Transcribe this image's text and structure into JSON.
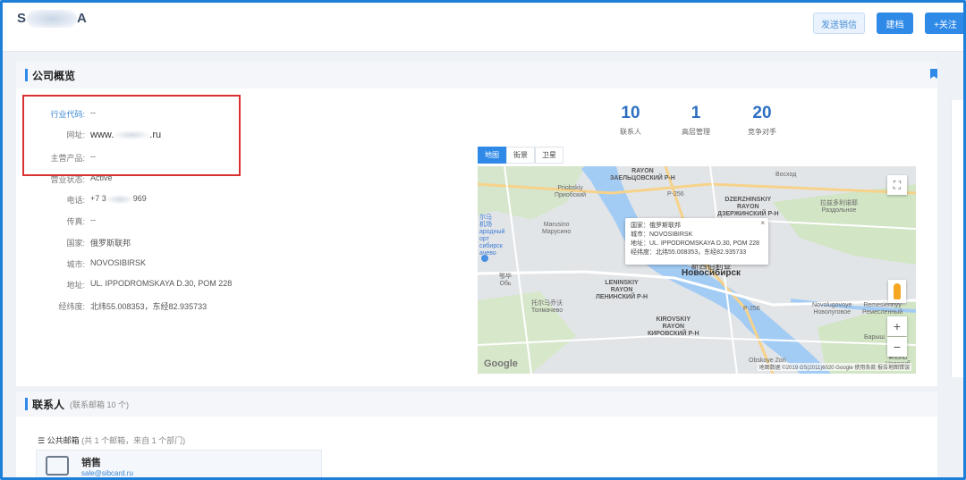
{
  "header": {
    "logo_left": "S",
    "logo_right": "A",
    "btn_send_message": "发送销信",
    "btn_archive": "建档",
    "btn_follow": "+关注"
  },
  "overview": {
    "title": "公司概览",
    "fields": [
      {
        "label": "行业代码:",
        "value": "--"
      },
      {
        "label": "网址:",
        "value_prefix": "www.",
        "value_suffix": ".ru"
      },
      {
        "label": "主营产品:",
        "value": "--"
      },
      {
        "label": "营业状态:",
        "value": "Active"
      },
      {
        "label": "电话:",
        "value_prefix": "+7 3",
        "value_suffix": "969"
      },
      {
        "label": "传真:",
        "value": "--"
      },
      {
        "label": "国家:",
        "value": "俄罗斯联邦"
      },
      {
        "label": "城市:",
        "value": "NOVOSIBIRSK"
      },
      {
        "label": "地址:",
        "value": "UL. IPPODROMSKAYA D.30, POM 228"
      },
      {
        "label": "经纬度:",
        "value": "北纬55.008353，东经82.935733"
      }
    ],
    "stats": [
      {
        "number": "10",
        "label": "联系人"
      },
      {
        "number": "1",
        "label": "高层管理"
      },
      {
        "number": "20",
        "label": "竞争对手"
      }
    ]
  },
  "map": {
    "tabs": [
      "地图",
      "街景",
      "卫星"
    ],
    "active_tab": "地图",
    "labels": {
      "zaeltsovsky": "RAYON\nЗАЕЛЬЦОВСКИЙ Р-Н",
      "dzerzhinsky": "DZERZHINSKIY\nRAYON\nДЗЕРЖИНСКИЙ Р-Н",
      "leninsky": "LENINSKIY\nRAYON\nЛЕНИНСКИЙ Р-Н",
      "kirovsky": "KIROVSKIY\nRAYON\nКИРОВСКИЙ Р-Н",
      "city_cn": "新西伯利亚",
      "city_ru": "Новосибирск",
      "voskhod": "Восход",
      "priobsky": "Priobskiy\nПриобский",
      "marusino": "Marusino\nМарусино",
      "razdolnoye": "拉兹多利诺耶\nРаздольное",
      "tolmachevo": "托尔马乔沃\nТолмачево",
      "ob": "鄂毕\nОбь",
      "novolugovoye": "Novolugovoye\nНоволуговое",
      "remeslenny": "Remesiennyy\nРемесленный",
      "barysh": "Барыш",
      "obskoye": "Obskoye Zori",
      "newnovo": "新西伯\nНовосиб",
      "airport": "尔马\n机场\nародный\nорт\nсибирск\nачево",
      "road1": "P-256",
      "road2": "P-256"
    },
    "info": {
      "country": "国家：俄罗斯联邦",
      "city": "城市：NOVOSIBIRSK",
      "address": "地址：UL. IPPODROMSKAYA D.30, POM 228",
      "coords": "经纬度：北纬55.008353，东经82.935733"
    },
    "google": "Google",
    "copyright": "地图数据 ©2019 GS(2011)6020 Google   使用条款   报告地图错误",
    "colors": {
      "water": "#a3ccf5",
      "land": "#e2e5e8",
      "park": "#cfe3c2",
      "road": "#ffffff",
      "highway": "#f6d28a"
    }
  },
  "contacts": {
    "title": "联系人",
    "subtitle": "(联系邮箱 10 个)",
    "mailbox_title": "公共邮箱",
    "mailbox_sub": "(共 1 个邮箱，来自 1 个部门)",
    "mailbox_item_name": "销售",
    "mailbox_item_email": "sale@sibcard.ru"
  }
}
